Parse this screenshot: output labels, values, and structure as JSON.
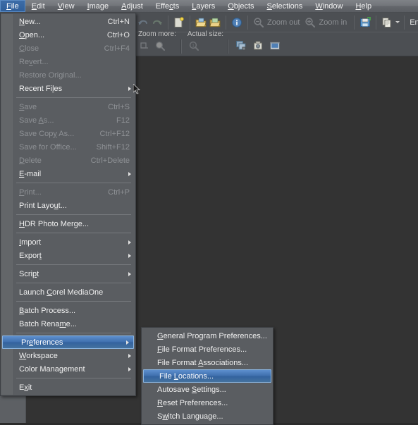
{
  "app": {
    "accent_highlight": "#3f6fae",
    "menubar_bg": "#73767b",
    "menu_bg": "#5a5d61",
    "canvas_bg": "#333333"
  },
  "menubar": {
    "items": [
      {
        "label": "File",
        "hotkey": "F",
        "active": true
      },
      {
        "label": "Edit",
        "hotkey": "E",
        "active": false
      },
      {
        "label": "View",
        "hotkey": "V",
        "active": false
      },
      {
        "label": "Image",
        "hotkey": "I",
        "active": false
      },
      {
        "label": "Adjust",
        "hotkey": "A",
        "active": false
      },
      {
        "label": "Effects",
        "hotkey": "c",
        "active": false
      },
      {
        "label": "Layers",
        "hotkey": "L",
        "active": false
      },
      {
        "label": "Objects",
        "hotkey": "O",
        "active": false
      },
      {
        "label": "Selections",
        "hotkey": "S",
        "active": false
      },
      {
        "label": "Window",
        "hotkey": "W",
        "active": false
      },
      {
        "label": "Help",
        "hotkey": "H",
        "active": false
      }
    ]
  },
  "toolbar": {
    "row1": [
      {
        "name": "undo-icon",
        "type": "icon",
        "enabled": false
      },
      {
        "name": "redo-icon",
        "type": "icon",
        "enabled": false
      },
      {
        "name": "separator",
        "type": "sep"
      },
      {
        "name": "new-image-icon",
        "type": "icon",
        "enabled": true
      },
      {
        "name": "separator",
        "type": "sep"
      },
      {
        "name": "open-icon",
        "type": "icon",
        "enabled": true
      },
      {
        "name": "browse-icon",
        "type": "icon",
        "enabled": true
      },
      {
        "name": "separator",
        "type": "sep"
      },
      {
        "name": "info-icon",
        "type": "icon",
        "enabled": true
      },
      {
        "name": "separator",
        "type": "sep"
      },
      {
        "name": "zoom-out-icon",
        "type": "icon",
        "enabled": false
      },
      {
        "name": "zoom-out-label",
        "type": "label",
        "label": "Zoom out",
        "enabled": false
      },
      {
        "name": "zoom-in-icon",
        "type": "icon",
        "enabled": false
      },
      {
        "name": "zoom-in-label",
        "type": "label",
        "label": "Zoom in",
        "enabled": false
      },
      {
        "name": "separator",
        "type": "sep"
      },
      {
        "name": "save-icon",
        "type": "icon",
        "enabled": true
      },
      {
        "name": "separator",
        "type": "sep"
      },
      {
        "name": "copy-icon",
        "type": "icon",
        "enabled": true
      },
      {
        "name": "copy-dropdown-caret",
        "type": "caret"
      },
      {
        "name": "separator",
        "type": "sep"
      },
      {
        "name": "enhance-photo-label",
        "type": "label",
        "label": "Enhanc",
        "enabled": true
      }
    ],
    "row2": {
      "group1_label": "Zoom more:",
      "group2_label": "Actual size:",
      "icons": [
        {
          "name": "zoom-more-in-icon"
        },
        {
          "name": "zoom-more-out-icon"
        },
        {
          "name": "actual-size-icon"
        },
        {
          "name": "duplicate-icon"
        },
        {
          "name": "capture-icon"
        },
        {
          "name": "screenshot-icon"
        }
      ]
    }
  },
  "file_menu": {
    "items": [
      {
        "type": "item",
        "label": "New...",
        "hotkey": "N",
        "accel": "Ctrl+N",
        "disabled": false,
        "submenu": false
      },
      {
        "type": "item",
        "label": "Open...",
        "hotkey": "O",
        "accel": "Ctrl+O",
        "disabled": false,
        "submenu": false
      },
      {
        "type": "item",
        "label": "Close",
        "hotkey": "C",
        "accel": "Ctrl+F4",
        "disabled": true,
        "submenu": false
      },
      {
        "type": "item",
        "label": "Revert...",
        "hotkey": "v",
        "accel": "",
        "disabled": true,
        "submenu": false
      },
      {
        "type": "item",
        "label": "Restore Original...",
        "hotkey": "",
        "accel": "",
        "disabled": true,
        "submenu": false
      },
      {
        "type": "item",
        "label": "Recent Files",
        "hotkey": "l",
        "accel": "",
        "disabled": false,
        "submenu": true
      },
      {
        "type": "sep"
      },
      {
        "type": "item",
        "label": "Save",
        "hotkey": "S",
        "accel": "Ctrl+S",
        "disabled": true,
        "submenu": false
      },
      {
        "type": "item",
        "label": "Save As...",
        "hotkey": "A",
        "accel": "F12",
        "disabled": true,
        "submenu": false
      },
      {
        "type": "item",
        "label": "Save Copy As...",
        "hotkey": "y",
        "accel": "Ctrl+F12",
        "disabled": true,
        "submenu": false
      },
      {
        "type": "item",
        "label": "Save for Office...",
        "hotkey": "",
        "accel": "Shift+F12",
        "disabled": true,
        "submenu": false
      },
      {
        "type": "item",
        "label": "Delete",
        "hotkey": "D",
        "accel": "Ctrl+Delete",
        "disabled": true,
        "submenu": false
      },
      {
        "type": "item",
        "label": "E-mail",
        "hotkey": "E",
        "accel": "",
        "disabled": false,
        "submenu": true
      },
      {
        "type": "sep"
      },
      {
        "type": "item",
        "label": "Print...",
        "hotkey": "P",
        "accel": "Ctrl+P",
        "disabled": true,
        "submenu": false
      },
      {
        "type": "item",
        "label": "Print Layout...",
        "hotkey": "u",
        "accel": "",
        "disabled": false,
        "submenu": false
      },
      {
        "type": "sep"
      },
      {
        "type": "item",
        "label": "HDR Photo Merge...",
        "hotkey": "H",
        "accel": "",
        "disabled": false,
        "submenu": false
      },
      {
        "type": "sep"
      },
      {
        "type": "item",
        "label": "Import",
        "hotkey": "I",
        "accel": "",
        "disabled": false,
        "submenu": true
      },
      {
        "type": "item",
        "label": "Export",
        "hotkey": "t",
        "accel": "",
        "disabled": false,
        "submenu": true
      },
      {
        "type": "sep"
      },
      {
        "type": "item",
        "label": "Script",
        "hotkey": "p",
        "accel": "",
        "disabled": false,
        "submenu": true
      },
      {
        "type": "sep"
      },
      {
        "type": "item",
        "label": "Launch Corel MediaOne",
        "hotkey": "C",
        "accel": "",
        "disabled": false,
        "submenu": false
      },
      {
        "type": "sep"
      },
      {
        "type": "item",
        "label": "Batch Process...",
        "hotkey": "B",
        "accel": "",
        "disabled": false,
        "submenu": false
      },
      {
        "type": "item",
        "label": "Batch Rename...",
        "hotkey": "m",
        "accel": "",
        "disabled": false,
        "submenu": false
      },
      {
        "type": "sep"
      },
      {
        "type": "item",
        "label": "Preferences",
        "hotkey": "e",
        "accel": "",
        "disabled": false,
        "submenu": true,
        "highlight": true
      },
      {
        "type": "item",
        "label": "Workspace",
        "hotkey": "W",
        "accel": "",
        "disabled": false,
        "submenu": true
      },
      {
        "type": "item",
        "label": "Color Management",
        "hotkey": "g",
        "accel": "",
        "disabled": false,
        "submenu": true
      },
      {
        "type": "sep"
      },
      {
        "type": "item",
        "label": "Exit",
        "hotkey": "x",
        "accel": "",
        "disabled": false,
        "submenu": false
      }
    ]
  },
  "preferences_submenu": {
    "items": [
      {
        "label": "General Program Preferences...",
        "hotkey": "G",
        "highlight": false
      },
      {
        "label": "File Format Preferences...",
        "hotkey": "F",
        "highlight": false
      },
      {
        "label": "File Format Associations...",
        "hotkey": "A",
        "highlight": false
      },
      {
        "label": "File Locations...",
        "hotkey": "L",
        "highlight": true
      },
      {
        "label": "Autosave Settings...",
        "hotkey": "S",
        "highlight": false
      },
      {
        "label": "Reset Preferences...",
        "hotkey": "R",
        "highlight": false
      },
      {
        "label": "Switch Language...",
        "hotkey": "w",
        "highlight": false
      }
    ]
  }
}
